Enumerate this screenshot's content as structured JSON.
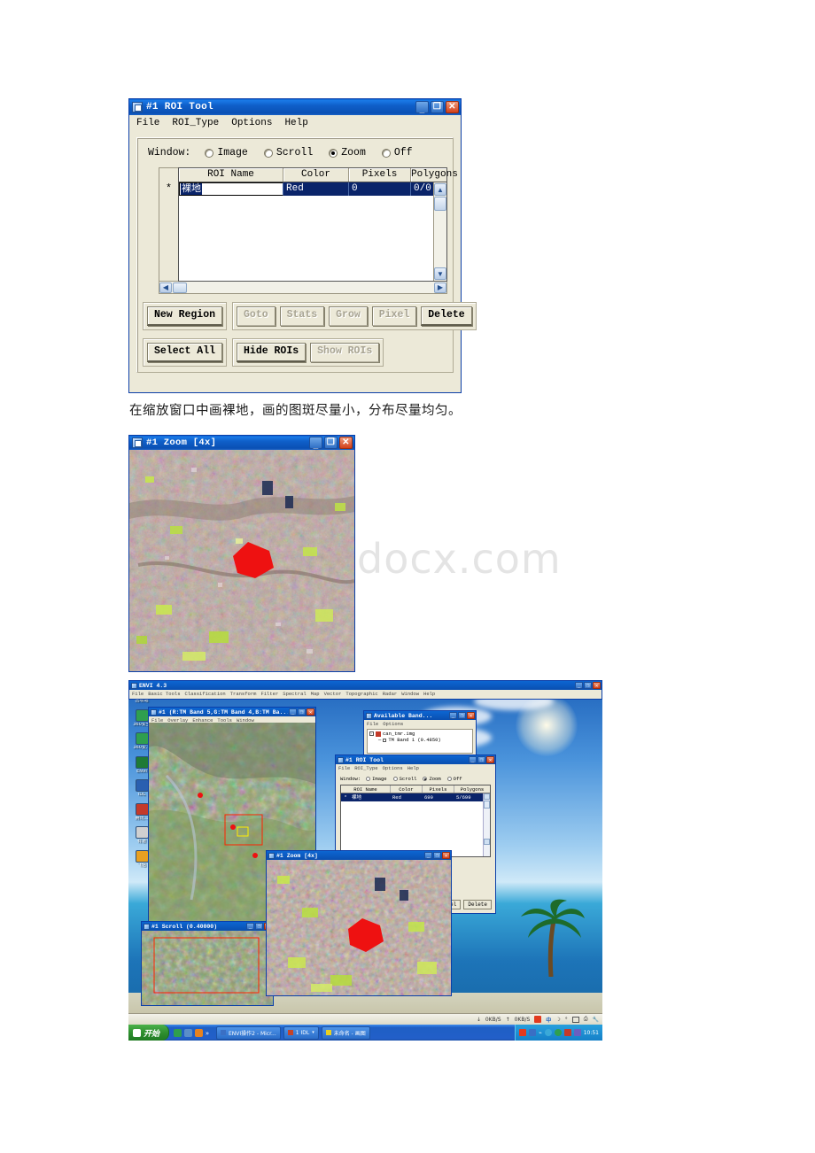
{
  "roi_tool": {
    "title": "#1 ROI Tool",
    "title_buttons": [
      "minimize",
      "maximize",
      "close"
    ],
    "menu": [
      "File",
      "ROI_Type",
      "Options",
      "Help"
    ],
    "window_label": "Window:",
    "window_options": [
      {
        "label": "Image",
        "selected": false
      },
      {
        "label": "Scroll",
        "selected": false
      },
      {
        "label": "Zoom",
        "selected": true
      },
      {
        "label": "Off",
        "selected": false
      }
    ],
    "table": {
      "row_marker": "*",
      "columns": [
        "ROI Name",
        "Color",
        "Pixels",
        "Polygons"
      ],
      "rows": [
        {
          "name": "裸地",
          "color": "Red",
          "pixels": "0",
          "polygons": "0/0",
          "selected": true,
          "editing": true
        }
      ]
    },
    "buttons_row1": [
      {
        "label": "New Region",
        "enabled": true
      },
      {
        "label": "Goto",
        "enabled": false
      },
      {
        "label": "Stats",
        "enabled": false
      },
      {
        "label": "Grow",
        "enabled": false
      },
      {
        "label": "Pixel",
        "enabled": false
      },
      {
        "label": "Delete",
        "enabled": true
      }
    ],
    "buttons_row2": [
      {
        "label": "Select All",
        "enabled": true
      },
      {
        "label": "Hide ROIs",
        "enabled": true
      },
      {
        "label": "Show ROIs",
        "enabled": false
      }
    ]
  },
  "caption": "在缩放窗口中画裸地，画的图斑尽量小，分布尽量均匀。",
  "watermark": "docx.com",
  "zoom_window": {
    "title": "#1 Zoom [4x]",
    "content_description": "satellite-false-color-image-with-red-roi-polygon"
  },
  "desktop": {
    "envi_main": {
      "title": "ENVI 4.3",
      "menu": [
        "File",
        "Basic Tools",
        "Classification",
        "Transform",
        "Filter",
        "Spectral",
        "Map",
        "Vector",
        "Topographic",
        "Radar",
        "Window",
        "Help"
      ]
    },
    "image_window": {
      "title": "#1 (R:TM Band 5,G:TM Band 4,B:TM Ba...",
      "menu": [
        "File",
        "Overlay",
        "Enhance",
        "Tools",
        "Window"
      ]
    },
    "available_bands": {
      "title": "Available Band...",
      "menu": [
        "File",
        "Options"
      ],
      "tree": [
        "can_tmr.img",
        "TM Band 1 (0.4850)"
      ]
    },
    "roi_tool_small": {
      "title": "#1 ROI Tool",
      "menu": [
        "File",
        "ROI_Type",
        "Options",
        "Help"
      ],
      "window_label": "Window:",
      "window_options": [
        {
          "label": "Image",
          "selected": false
        },
        {
          "label": "Scroll",
          "selected": false
        },
        {
          "label": "Zoom",
          "selected": true
        },
        {
          "label": "Off",
          "selected": false
        }
      ],
      "columns": [
        "ROI Name",
        "Color",
        "Pixels",
        "Polygons"
      ],
      "row": {
        "name": "裸地",
        "color": "Red",
        "pixels": "699",
        "polygons": "5/699"
      },
      "buttons": [
        "Pixel",
        "Delete"
      ]
    },
    "scroll_window": {
      "title": "#1 Scroll (0.40000)"
    },
    "zoom_window": {
      "title": "#1 Zoom [4x]"
    },
    "desktop_icons": [
      {
        "label": "回收站",
        "color": "#5a8ec9"
      },
      {
        "label": "360安全",
        "color": "#2f9f4f"
      },
      {
        "label": "360安...",
        "color": "#2f9f4f"
      },
      {
        "label": "ENVI",
        "color": "#1f7a36"
      },
      {
        "label": "IDL",
        "color": "#2a5fb0"
      },
      {
        "label": "腾讯...",
        "color": "#c43a2a"
      },
      {
        "label": "有道",
        "color": "#d0d0d0"
      },
      {
        "label": "飞信",
        "color": "#e8a020"
      }
    ],
    "status_bar": {
      "download_speed": "0KB/S",
      "upload_speed": "0KB/S",
      "ime": "中"
    },
    "taskbar": {
      "start_label": "开始",
      "tasks": [
        {
          "label": "ENVI操作2 - Micr..."
        },
        {
          "label": "1 IDL"
        },
        {
          "label": "未命名 - 画图"
        }
      ],
      "clock": "10:51"
    }
  }
}
